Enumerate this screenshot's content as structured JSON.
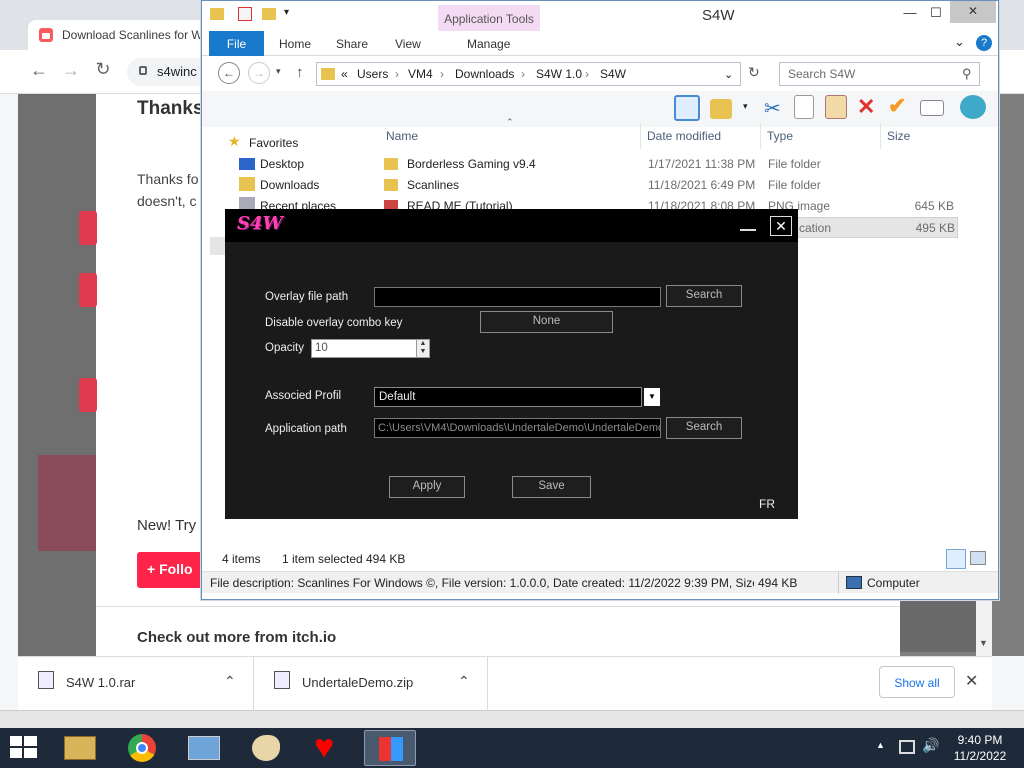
{
  "chrome": {
    "tab_title": "Download Scanlines for W",
    "url": "s4winc",
    "page": {
      "heading": "Thanks",
      "para_line1": "Thanks fo",
      "para_line2": "doesn't, c",
      "new_try": "New! Try",
      "follow_label": "Follo",
      "check_out": "Check out more from itch.io"
    },
    "downloads": [
      {
        "name": "S4W 1.0.rar"
      },
      {
        "name": "UndertaleDemo.zip"
      }
    ],
    "show_all": "Show all"
  },
  "explorer": {
    "title": "S4W",
    "app_tools": "Application Tools",
    "ribbon_tabs": [
      "File",
      "Home",
      "Share",
      "View",
      "Manage"
    ],
    "breadcrumb": [
      "«",
      "Users",
      "VM4",
      "Downloads",
      "S4W 1.0",
      "S4W"
    ],
    "search_placeholder": "Search S4W",
    "nav": {
      "favorites": "Favorites",
      "items": [
        "Desktop",
        "Downloads",
        "Recent places"
      ]
    },
    "columns": {
      "name": "Name",
      "date": "Date modified",
      "type": "Type",
      "size": "Size"
    },
    "files": [
      {
        "name": "Borderless Gaming v9.4",
        "date": "1/17/2021 11:38 PM",
        "type": "File folder",
        "size": ""
      },
      {
        "name": "Scanlines",
        "date": "11/18/2021 6:49 PM",
        "type": "File folder",
        "size": ""
      },
      {
        "name": "READ ME (Tutorial)",
        "date": "11/18/2021 8:08 PM",
        "type": "PNG image",
        "size": "645 KB"
      },
      {
        "name": "",
        "date": "",
        "type": "cation",
        "size": "495 KB"
      }
    ],
    "status": {
      "items": "4 items",
      "selected": "1 item selected",
      "size": "494 KB"
    },
    "description": "File description: Scanlines For Windows ©, File version: 1.0.0.0, Date created: 11/2/2022 9:39 PM, Size: 49",
    "desc_size": "494 KB",
    "computer": "Computer"
  },
  "s4w": {
    "logo": "S4W",
    "overlay_label": "Overlay file path",
    "overlay_value": "",
    "search_label": "Search",
    "combo_label": "Disable overlay combo key",
    "combo_value": "None",
    "opacity_label": "Opacity",
    "opacity_value": "10",
    "profile_label": "Associed Profil",
    "profile_value": "Default",
    "app_path_label": "Application path",
    "app_path_value": "C:\\Users\\VM4\\Downloads\\UndertaleDemo\\UndertaleDemo",
    "search2_label": "Search",
    "apply_label": "Apply",
    "save_label": "Save",
    "lang": "FR"
  },
  "taskbar": {
    "time": "9:40 PM",
    "date": "11/2/2022"
  },
  "colors": {
    "explorer_accent": "#1979ca",
    "s4w_logo": "#ff3fb4",
    "follow_button": "#ff2449"
  }
}
